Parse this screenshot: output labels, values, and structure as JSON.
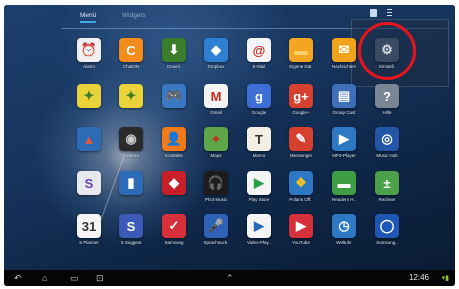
{
  "tabs": [
    {
      "label": "Menü"
    },
    {
      "label": "Widgets"
    }
  ],
  "apps": [
    {
      "label": "Alarm",
      "glyph": "⏰",
      "color": "#f0f0f0",
      "fg": "#333333",
      "icon": "alarm-clock-icon"
    },
    {
      "label": "ChatON",
      "glyph": "C",
      "color": "#f28c1a",
      "fg": "#ffffff",
      "icon": "chaton-icon"
    },
    {
      "label": "Downl.",
      "glyph": "⬇",
      "color": "#3a7d2a",
      "fg": "#ffffff",
      "icon": "download-icon"
    },
    {
      "label": "Dropbox",
      "glyph": "◆",
      "color": "#2f7fd3",
      "fg": "#ffffff",
      "icon": "dropbox-icon"
    },
    {
      "label": "E-Mail",
      "glyph": "@",
      "color": "#f4f4f4",
      "fg": "#d0281e",
      "icon": "email-icon"
    },
    {
      "label": "Eigene Dat.",
      "glyph": "▬",
      "color": "#f4a623",
      "fg": "#ffd36b",
      "icon": "folder-icon"
    },
    {
      "label": "Nachrichten",
      "glyph": "✉",
      "color": "#f2a21a",
      "fg": "#ffffff",
      "icon": "messages-icon"
    },
    {
      "label": "Einstell.",
      "glyph": "⚙",
      "color": "#3a4a62",
      "fg": "#cfd8e3",
      "icon": "settings-gear-icon"
    },
    {
      "label": "",
      "glyph": "✦",
      "color": "#e9d23a",
      "fg": "#3a7d2a",
      "icon": "flipboard-icon"
    },
    {
      "label": "",
      "glyph": "✦",
      "color": "#e9d23a",
      "fg": "#3a7d2a",
      "icon": "feature-app-icon"
    },
    {
      "label": "",
      "glyph": "🎮",
      "color": "#3b78c2",
      "fg": "#ffffff",
      "icon": "game-hub-icon"
    },
    {
      "label": "Gmail",
      "glyph": "M",
      "color": "#f4f4f4",
      "fg": "#d0281e",
      "icon": "gmail-icon"
    },
    {
      "label": "Google",
      "glyph": "g",
      "color": "#3d6fd6",
      "fg": "#ffffff",
      "icon": "google-search-icon"
    },
    {
      "label": "Google+",
      "glyph": "g+",
      "color": "#d6402f",
      "fg": "#ffffff",
      "icon": "google-plus-icon"
    },
    {
      "label": "Group Cast",
      "glyph": "▤",
      "color": "#3e6fb8",
      "fg": "#ffffff",
      "icon": "group-cast-icon"
    },
    {
      "label": "Hilfe",
      "glyph": "?",
      "color": "#7a8696",
      "fg": "#ffffff",
      "icon": "help-icon"
    },
    {
      "label": "",
      "glyph": "▲",
      "color": "#2c6bb5",
      "fg": "#e5553b",
      "icon": "apps-icon"
    },
    {
      "label": "Kamera",
      "glyph": "◉",
      "color": "#2b2b2b",
      "fg": "#c9c9c9",
      "icon": "camera-icon"
    },
    {
      "label": "Kontakte",
      "glyph": "👤",
      "color": "#f07a1a",
      "fg": "#ffffff",
      "icon": "contacts-icon"
    },
    {
      "label": "Maps",
      "glyph": "⌖",
      "color": "#5fa64a",
      "fg": "#d0281e",
      "icon": "maps-icon"
    },
    {
      "label": "Memo",
      "glyph": "T",
      "color": "#f3f0e3",
      "fg": "#333333",
      "icon": "memo-icon"
    },
    {
      "label": "Messenger",
      "glyph": "✎",
      "color": "#d6402f",
      "fg": "#ffffff",
      "icon": "messenger-icon"
    },
    {
      "label": "MP3-Player",
      "glyph": "▶",
      "color": "#2f78c4",
      "fg": "#ffffff",
      "icon": "music-player-icon"
    },
    {
      "label": "Music Hub",
      "glyph": "◎",
      "color": "#2456a8",
      "fg": "#ffffff",
      "icon": "music-hub-icon"
    },
    {
      "label": "",
      "glyph": "S",
      "color": "#e8e8ef",
      "fg": "#6a3fb0",
      "icon": "s-note-icon"
    },
    {
      "label": "",
      "glyph": "▮",
      "color": "#2c6bb5",
      "fg": "#ffffff",
      "icon": "book-app-icon"
    },
    {
      "label": "",
      "glyph": "◆",
      "color": "#c8202a",
      "fg": "#ffffff",
      "icon": "red-app-icon"
    },
    {
      "label": "Phot Music",
      "glyph": "🎧",
      "color": "#1c1c1c",
      "fg": "#f0a81a",
      "icon": "headphones-icon"
    },
    {
      "label": "Play Store",
      "glyph": "▶",
      "color": "#f4f4f4",
      "fg": "#2c9d4a",
      "icon": "play-store-icon"
    },
    {
      "label": "Polaris Off..",
      "glyph": "❖",
      "color": "#2c78c4",
      "fg": "#f0c020",
      "icon": "polaris-office-icon"
    },
    {
      "label": "Readers H..",
      "glyph": "▬",
      "color": "#3f9d45",
      "fg": "#ffffff",
      "icon": "readers-hub-icon"
    },
    {
      "label": "Rechner",
      "glyph": "±",
      "color": "#4aa14a",
      "fg": "#ffffff",
      "icon": "calculator-icon"
    },
    {
      "label": "S Planner",
      "glyph": "31",
      "color": "#f4f4f4",
      "fg": "#333333",
      "icon": "calendar-icon"
    },
    {
      "label": "S Suggest",
      "glyph": "S",
      "color": "#3b5ab8",
      "fg": "#ffffff",
      "icon": "s-suggest-icon"
    },
    {
      "label": "Samsung",
      "glyph": "✓",
      "color": "#d6303a",
      "fg": "#ffffff",
      "icon": "samsung-apps-icon"
    },
    {
      "label": "Sprachsuch.",
      "glyph": "🎤",
      "color": "#2d62b8",
      "fg": "#ffffff",
      "icon": "voice-search-icon"
    },
    {
      "label": "Video-Play..",
      "glyph": "▶",
      "color": "#f4f4f4",
      "fg": "#2c6bb5",
      "icon": "video-player-icon"
    },
    {
      "label": "YouTube",
      "glyph": "▶",
      "color": "#d6303a",
      "fg": "#ffffff",
      "icon": "youtube-icon"
    },
    {
      "label": "Weltuhr",
      "glyph": "◷",
      "color": "#2d78c4",
      "fg": "#ffffff",
      "icon": "world-clock-icon"
    },
    {
      "label": "Samsung..",
      "glyph": "◯",
      "color": "#1f57b5",
      "fg": "#ffffff",
      "icon": "samsung-link-icon"
    }
  ],
  "statusbar": {
    "time": "12:46"
  },
  "page_indicator": {
    "pages": 2,
    "current": 1
  }
}
